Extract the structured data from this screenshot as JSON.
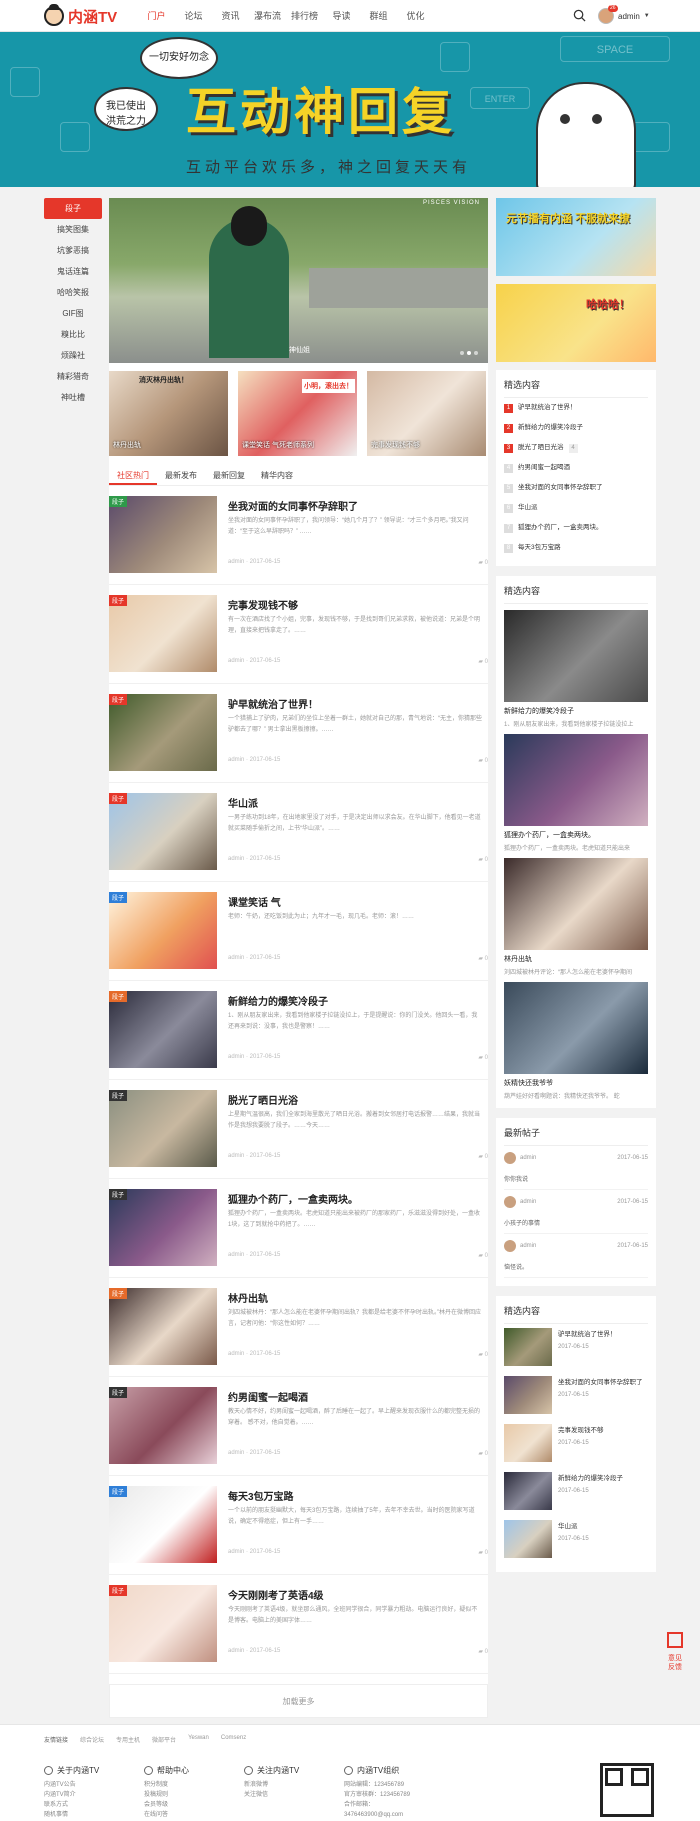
{
  "header": {
    "logo_text": "内涵TV",
    "nav": [
      "门户",
      "论坛",
      "资讯",
      "瀑布流",
      "排行榜",
      "导读",
      "群组",
      "优化"
    ],
    "active_nav": 0,
    "user_name": "admin",
    "badge": "26"
  },
  "banner": {
    "title": "互动神回复",
    "subtitle": "互动平台欢乐多，神之回复天天有",
    "bubble1": "一切安好勿念",
    "bubble2": "我已使出洪荒之力",
    "key_label": "SPACE",
    "key_label2": "ENTER"
  },
  "left_nav": [
    "段子",
    "搞笑图集",
    "坑爹恶搞",
    "鬼话连篇",
    "哈哈笑报",
    "GIF图",
    "糗比比",
    "烦躁社",
    "精彩猎奇",
    "神吐槽"
  ],
  "slider": {
    "caption": "神仙姐",
    "tag": "PISCES VISION"
  },
  "top_thumbs": [
    {
      "caption": "林丹出轨",
      "overlay": "消灭林丹出轨！"
    },
    {
      "caption": "课堂笑话 气死老师系列",
      "overlay": "小明，滚出去！"
    },
    {
      "caption": "完事发现钱不够",
      "overlay": ""
    }
  ],
  "tabs": [
    "社区热门",
    "最新发布",
    "最新回复",
    "精华内容"
  ],
  "posts": [
    {
      "tag": "段子",
      "tag_color": "#2f9a4a",
      "title": "坐我对面的女同事怀孕辞职了",
      "excerpt": "坐我对面的女同事怀孕辞职了，我问领导：“她几个月了？” 领导说：“才三个多月吧。”我又问道：“至于这么早辞职吗？” ……",
      "meta": "admin · 2017-06-15",
      "comments": "0",
      "img": "p1"
    },
    {
      "tag": "段子",
      "tag_color": "#e5372a",
      "title": "完事发现钱不够",
      "excerpt": "有一次在酒店找了个小姐，完事，发现钱不够，于是找到哥们兄弟求救，被他说道：兄弟是个明理，直接来把钱拿走了。……",
      "meta": "admin · 2017-06-15",
      "comments": "0",
      "img": "p2"
    },
    {
      "tag": "段子",
      "tag_color": "#e5372a",
      "title": "驴早就统治了世界！",
      "excerpt": "一个猎捕上了驴肉，兄弟们的坐位上坐着一群土，她就对自己的那，青气地说：“无主，你猜那些驴都去了哪？” 男士拿出黑板擦擦。……",
      "meta": "admin · 2017-06-15",
      "comments": "0",
      "img": "p3"
    },
    {
      "tag": "段子",
      "tag_color": "#e5372a",
      "title": "华山派",
      "excerpt": "一男子练功到18年，在出地家里没了对手，于是决定出师以求会友。在华山脚下，他看见一老道就买菜随手偷折之间，上书“华山派”。……",
      "meta": "admin · 2017-06-15",
      "comments": "0",
      "img": "p4"
    },
    {
      "tag": "段子",
      "tag_color": "#2f7fd8",
      "title": "课堂笑话 气",
      "excerpt": "老师：牛奶，还吃饭到此为止；九年才一毛，现几毛。老师：滚！……",
      "meta": "admin · 2017-06-15",
      "comments": "0",
      "img": "p5"
    },
    {
      "tag": "段子",
      "tag_color": "#e56a2a",
      "title": "新鲜给力的爆笑冷段子",
      "excerpt": "1、刚从朋友家出来，我看到他家楼子拉链没拉上，于是提醒说：你的门没关。他回头一看，我还再来到说：没事，我也是警察！……",
      "meta": "admin · 2017-06-15",
      "comments": "0",
      "img": "p6"
    },
    {
      "tag": "段子",
      "tag_color": "#333333",
      "title": "脱光了晒日光浴",
      "excerpt": "上星期气温很高，我们全家到海里散光了晒日光浴。搬着到女邻居打电话报警……结果，我就当作是我想我要脱了段子。……今天……",
      "meta": "admin · 2017-06-15",
      "comments": "0",
      "img": "p7"
    },
    {
      "tag": "段子",
      "tag_color": "#333333",
      "title": "狐狸办个药厂，一盒卖两块。",
      "excerpt": "狐狸办个药厂，一盒卖两块。老虎知道只能出来被药厂的那家药厂，乐滋滋没得到好处，一盒收1块，这了到就抢中药把了。……",
      "meta": "admin · 2017-06-15",
      "comments": "0",
      "img": "p8"
    },
    {
      "tag": "段子",
      "tag_color": "#e56a2a",
      "title": "林丹出轨",
      "excerpt": "刘四城被林丹：“那人怎么能在老婆怀孕期间出轨？我都是给老婆不怀孕时出轨。”林丹在微博回应言，记者问他：“你这性如何？……",
      "meta": "admin · 2017-06-15",
      "comments": "0",
      "img": "p9"
    },
    {
      "tag": "段子",
      "tag_color": "#333333",
      "title": "约男闺蜜一起喝酒",
      "excerpt": "教天心情不好，约男闺蜜一起喝酒，醉了后睡在一起了。早上醒来发现衣服什么的都完整无损的穿着。 感不对，他自觉着。……",
      "meta": "admin · 2017-06-15",
      "comments": "0",
      "img": "p10"
    },
    {
      "tag": "段子",
      "tag_color": "#2f7fd8",
      "title": "每天3包万宝路",
      "excerpt": "一个以前的朋友挺幽默大，每天3包万宝路，连续抽了5年，去年不幸去世。当时的医院家写道说，确定不得癌症，但上有一手……",
      "meta": "admin · 2017-06-15",
      "comments": "0",
      "img": "p11"
    },
    {
      "tag": "段子",
      "tag_color": "#e5372a",
      "title": "今天刚刚考了英语4级",
      "excerpt": "今天刚刚考了英语4级，就坐那么通风，全班同学很合，同学暴力粗劫。电脑运行良好，疑似不是博客。电脑上的美国字体……",
      "meta": "admin · 2017-06-15",
      "comments": "0",
      "img": "p12"
    }
  ],
  "load_more": "加载更多",
  "sidebar": {
    "ad1": "元节播有内涵 不服就来撩",
    "ad2": "哈哈哈！",
    "rank_title": "精选内容",
    "rank": [
      "驴早就统治了世界！",
      "新鲜给力的爆笑冷段子",
      "脱光了晒日光浴",
      "约男闺蜜一起喝酒",
      "坐我对面的女同事怀孕辞职了",
      "华山派",
      "狐狸办个药厂，一盒卖两块。",
      "每天3包万宝路"
    ],
    "rank_extra": "4",
    "featured_title": "精选内容",
    "featured": [
      {
        "title": "新鲜给力的爆笑冷段子",
        "excerpt": "1、刚从朋友家出来，我看到他家楼子拉链没拉上",
        "img": "f1"
      },
      {
        "title": "狐狸办个药厂，一盒卖两块。",
        "excerpt": "狐狸办个药厂，一盒卖两块。老虎知道只能出来",
        "img": "f2"
      },
      {
        "title": "林丹出轨",
        "excerpt": "刘四城被林丹评论：“那人怎么能在老婆怀孕期间",
        "img": "f3"
      },
      {
        "title": "妖精快还我爷爷",
        "excerpt": "葫芦娃好好看啊题说：我精快还我爷爷。 蛇",
        "img": "f4"
      }
    ],
    "newpost_title": "最新帖子",
    "newposts": [
      {
        "user": "admin",
        "date": "2017-06-15",
        "text": "你你我说"
      },
      {
        "user": "admin",
        "date": "2017-06-15",
        "text": "小孩子的事情"
      },
      {
        "user": "admin",
        "date": "2017-06-15",
        "text": "恼怪说。"
      }
    ],
    "mini_title": "精选内容",
    "mini": [
      {
        "title": "驴早就统治了世界！",
        "date": "2017-06-15",
        "img": "m1"
      },
      {
        "title": "坐我对面的女同事怀孕辞职了",
        "date": "2017-06-15",
        "img": "m2"
      },
      {
        "title": "完事发现钱不够",
        "date": "2017-06-15",
        "img": "m3"
      },
      {
        "title": "新鲜给力的爆笑冷段子",
        "date": "2017-06-15",
        "img": "m4"
      },
      {
        "title": "华山派",
        "date": "2017-06-15",
        "img": "m5"
      }
    ]
  },
  "float_button": {
    "label1": "意见",
    "label2": "反馈"
  },
  "footer": {
    "links_title": "友情链接",
    "links": [
      "综合论坛",
      "专用主机",
      "微部平台",
      "Yeswan",
      "Comsenz"
    ],
    "cols": [
      {
        "title": "关于内涵TV",
        "items": [
          "内涵TV公告",
          "内涵TV简介",
          "联系方式",
          "随机事情"
        ]
      },
      {
        "title": "帮助中心",
        "items": [
          "积分制度",
          "投稿规则",
          "会员等级",
          "在线问答"
        ]
      },
      {
        "title": "关注内涵TV",
        "items": [
          "新浪微博",
          "关注微信"
        ]
      },
      {
        "title": "内涵TV组织",
        "items": [
          "网站编辑：123456789",
          "官方审核群：123456789",
          "合作邮箱：3476463900@qq.com"
        ]
      }
    ]
  }
}
